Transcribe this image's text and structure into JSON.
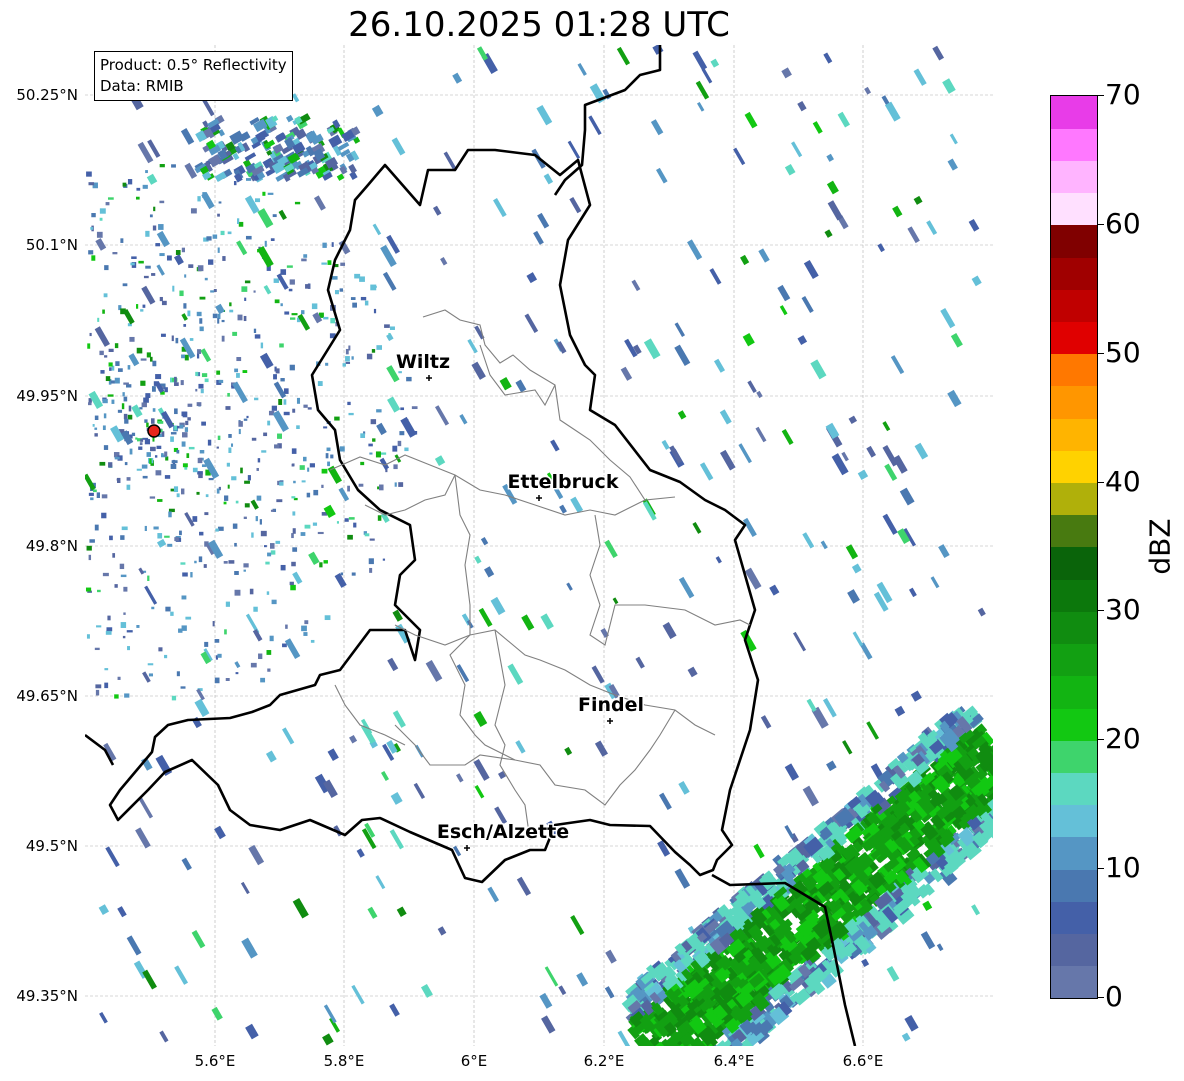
{
  "title": "26.10.2025 01:28 UTC",
  "info_box": {
    "product": "Product: 0.5° Reflectivity",
    "data": "Data: RMIB"
  },
  "latitude_ticks": [
    "50.25°N",
    "50.1°N",
    "49.95°N",
    "49.8°N",
    "49.65°N",
    "49.5°N",
    "49.35°N"
  ],
  "longitude_ticks": [
    "5.6°E",
    "5.8°E",
    "6°E",
    "6.2°E",
    "6.4°E",
    "6.6°E"
  ],
  "cities": [
    {
      "name": "Wiltz"
    },
    {
      "name": "Ettelbruck"
    },
    {
      "name": "Findel"
    },
    {
      "name": "Esch/Alzette"
    }
  ],
  "radar_site": {
    "color": "#e8251c"
  },
  "colorbar": {
    "unit": "dBZ",
    "tick_labels": [
      "0",
      "10",
      "20",
      "30",
      "40",
      "50",
      "60",
      "70"
    ],
    "colors": [
      "#6677aa",
      "#5566a0",
      "#4460a8",
      "#4a78b0",
      "#5596c4",
      "#64c0d8",
      "#5cd8c0",
      "#3ed46c",
      "#12c812",
      "#12b412",
      "#12a012",
      "#108c10",
      "#0c780c",
      "#0a640a",
      "#487a10",
      "#b0b00a",
      "#ffd200",
      "#ffb400",
      "#ff9600",
      "#ff7800",
      "#e00000",
      "#c00000",
      "#a00000",
      "#800000",
      "#ffe0ff",
      "#ffb4ff",
      "#ff78ff",
      "#e83ce8"
    ]
  }
}
